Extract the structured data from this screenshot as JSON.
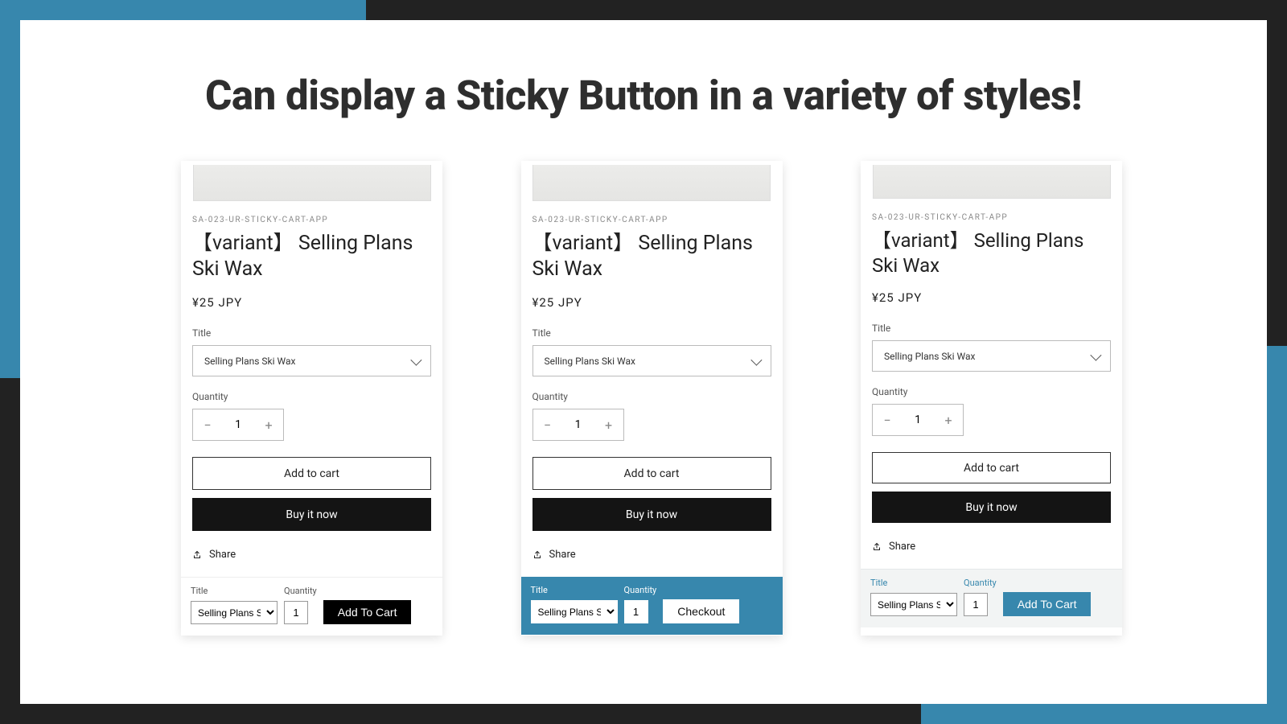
{
  "headline": "Can display a Sticky Button in a variety of styles!",
  "product": {
    "vendor": "SA-023-UR-STICKY-CART-APP",
    "title": "【variant】 Selling Plans Ski Wax",
    "price": "¥25 JPY",
    "variant_label": "Title",
    "variant_value": "Selling Plans Ski Wax",
    "quantity_label": "Quantity",
    "quantity_value": "1",
    "add_to_cart_label": "Add to cart",
    "buy_now_label": "Buy it now",
    "share_label": "Share"
  },
  "sticky": {
    "title_label": "Title",
    "quantity_label": "Quantity",
    "select_value": "Selling Plans Ski …",
    "qty_value": "1",
    "variants": [
      {
        "button_label": "Add To Cart"
      },
      {
        "button_label": "Checkout"
      },
      {
        "button_label": "Add To Cart"
      }
    ]
  }
}
